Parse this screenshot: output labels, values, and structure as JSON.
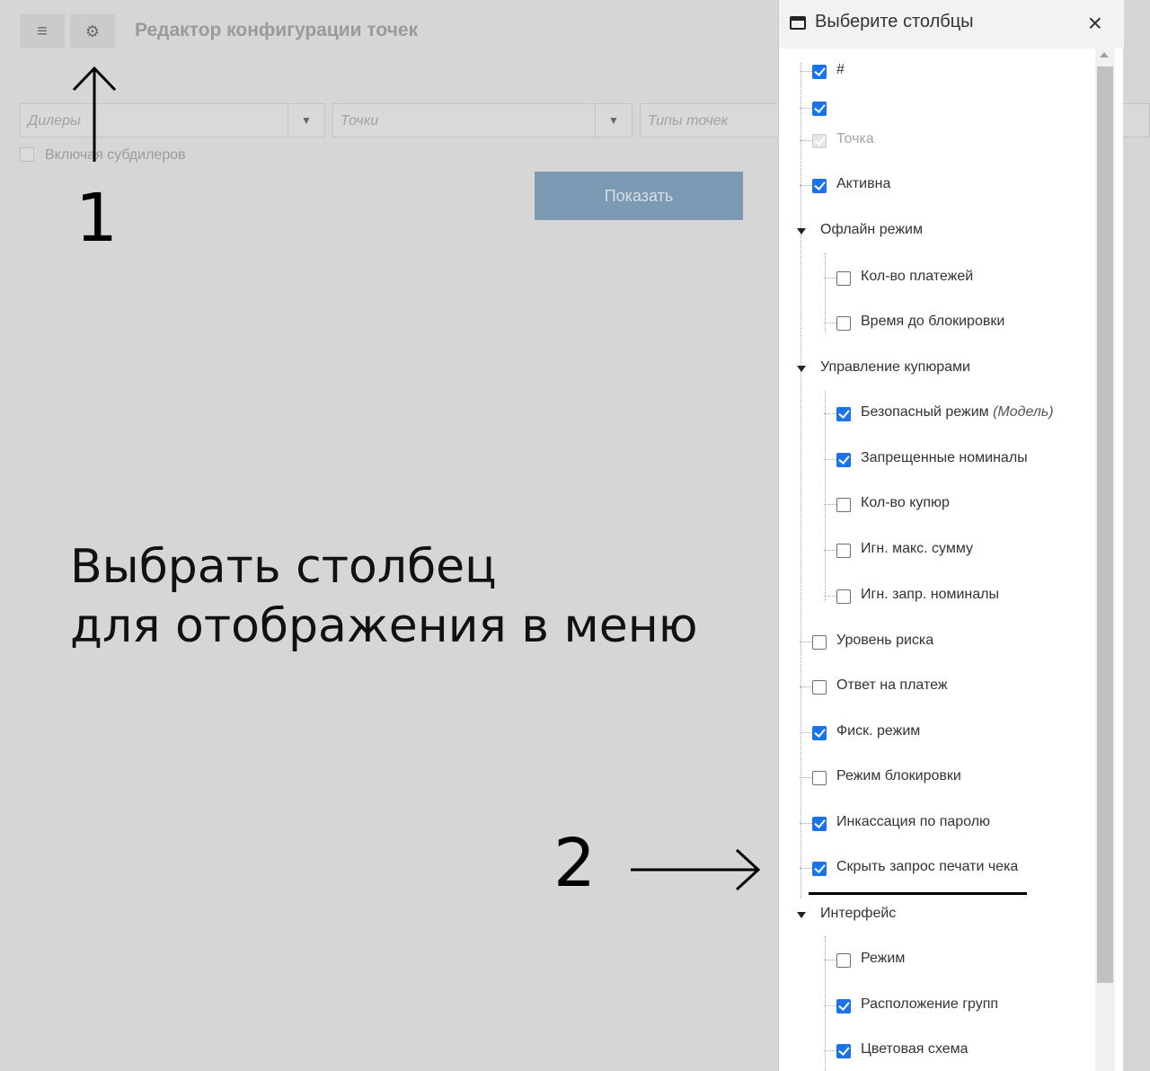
{
  "toolbar": {
    "menu_icon": "hamburger-icon",
    "settings_icon": "gear-icon"
  },
  "page": {
    "title": "Редактор конфигурации точек"
  },
  "filters": {
    "dealers_placeholder": "Дилеры",
    "points_placeholder": "Точки",
    "point_types_placeholder": "Типы точек",
    "include_subdealers": "Включая субдилеров",
    "show_button": "Показать"
  },
  "annotations": {
    "num1": "1",
    "num2": "2",
    "line1": "Выбрать столбец",
    "line2": "для отображения в меню"
  },
  "panel": {
    "title": "Выберите столбцы",
    "close": "×",
    "items": [
      {
        "label": "#",
        "checked": true
      },
      {
        "label": "",
        "checked": true
      },
      {
        "label": "Точка",
        "checked": true,
        "disabled": true
      },
      {
        "label": "Активна",
        "checked": true
      },
      {
        "group": "Офлайн режим"
      },
      {
        "label": "Кол-во платежей",
        "checked": false
      },
      {
        "label": "Время до блокировки",
        "checked": false
      },
      {
        "group": "Управление купюрами"
      },
      {
        "label": "Безопасный режим",
        "label_extra": "(Модель)",
        "checked": true
      },
      {
        "label": "Запрещенные номиналы",
        "checked": true
      },
      {
        "label": "Кол-во купюр",
        "checked": false
      },
      {
        "label": "Игн. макс. сумму",
        "checked": false
      },
      {
        "label": "Игн. запр. номиналы",
        "checked": false
      },
      {
        "label": "Уровень риска",
        "checked": false
      },
      {
        "label": "Ответ на платеж",
        "checked": false
      },
      {
        "label": "Фиск. режим",
        "checked": true
      },
      {
        "label": "Режим блокировки",
        "checked": false
      },
      {
        "label": "Инкассация по паролю",
        "checked": true
      },
      {
        "label": "Скрыть запрос печати чека",
        "checked": true
      },
      {
        "group": "Интерфейс"
      },
      {
        "label": "Режим",
        "checked": false
      },
      {
        "label": "Расположение групп",
        "checked": true
      },
      {
        "label": "Цветовая схема",
        "checked": true
      }
    ]
  }
}
